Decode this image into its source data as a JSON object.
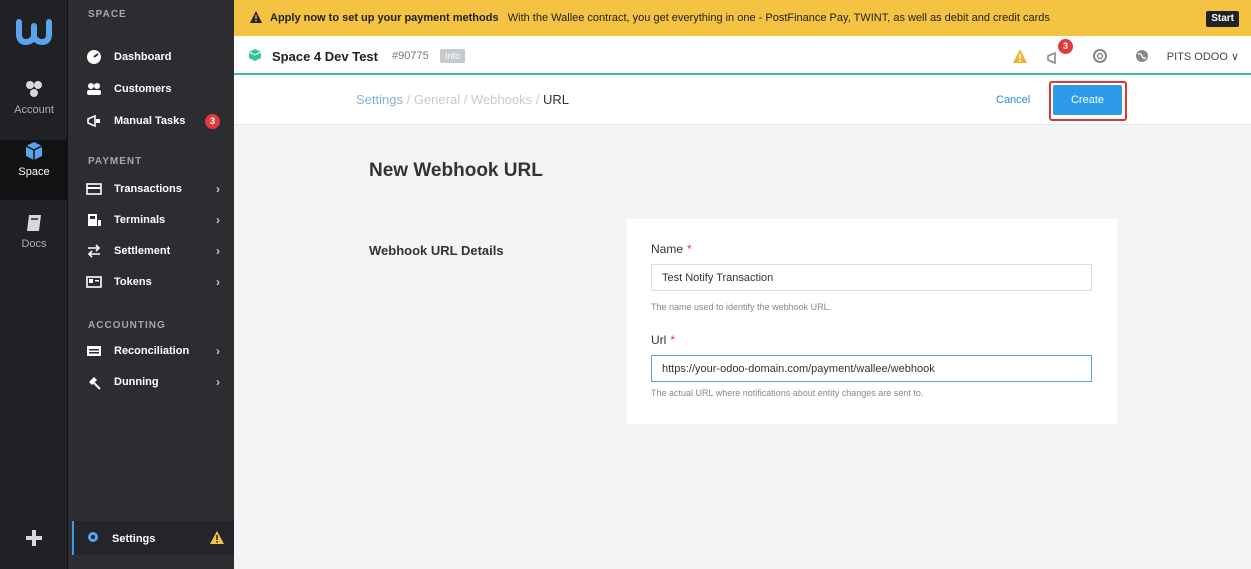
{
  "rail": {
    "items": [
      {
        "label": "Account",
        "icon": "account-icon"
      },
      {
        "label": "Space",
        "icon": "cube-icon"
      },
      {
        "label": "Docs",
        "icon": "book-icon"
      }
    ]
  },
  "sidebar": {
    "space_label": "SPACE",
    "payment_label": "PAYMENT",
    "accounting_label": "ACCOUNTING",
    "items": [
      {
        "label": "Dashboard"
      },
      {
        "label": "Customers"
      },
      {
        "label": "Manual Tasks",
        "badge": "3"
      },
      {
        "label": "Transactions"
      },
      {
        "label": "Terminals"
      },
      {
        "label": "Settlement"
      },
      {
        "label": "Tokens"
      },
      {
        "label": "Reconciliation"
      },
      {
        "label": "Dunning"
      }
    ],
    "settings_label": "Settings"
  },
  "banner": {
    "bold_text": "Apply now to set up your payment methods",
    "text": "With the Wallee contract, you get everything in one - PostFinance Pay, TWINT, as well as debit and credit cards",
    "start_label": "Start"
  },
  "header": {
    "space_name": "Space 4 Dev Test",
    "space_id": "#90775",
    "info_label": "Info",
    "notification_count": "3",
    "user_label": "PITS ODOO ∨"
  },
  "actionbar": {
    "breadcrumb_settings": "Settings",
    "breadcrumb_sep1": " / ",
    "breadcrumb_general": "General",
    "breadcrumb_sep2": " / ",
    "breadcrumb_webhooks": "Webhooks",
    "breadcrumb_sep3": " / ",
    "breadcrumb_current": "URL",
    "cancel_label": "Cancel",
    "create_label": "Create"
  },
  "main": {
    "page_title": "New Webhook URL",
    "section_title": "Webhook URL Details",
    "fields": [
      {
        "label": "Name",
        "required": "*",
        "value": "Test Notify Transaction",
        "help": "The name used to identify the webhook URL."
      },
      {
        "label": "Url",
        "required": "*",
        "value": "https://your-odoo-domain.com/payment/wallee/webhook",
        "help": "The actual URL where notifications about entity changes are sent to."
      }
    ]
  },
  "colors": {
    "accent": "#2d9be7",
    "banner": "#f5c342",
    "highlight": "#d83838",
    "badge": "#e0393e"
  }
}
